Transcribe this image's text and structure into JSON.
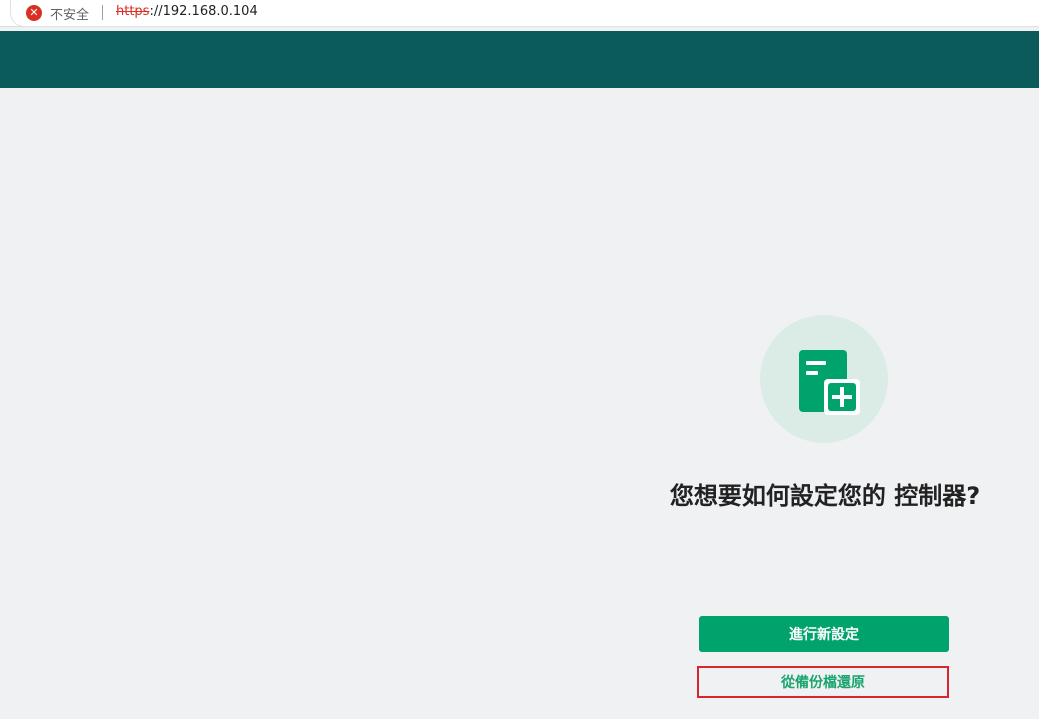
{
  "browser": {
    "security_label": "不安全",
    "url_scheme": "https",
    "url_rest": "://192.168.0.104"
  },
  "setup": {
    "icon": "document-add-icon",
    "question": "您想要如何設定您的 控制器?",
    "new_setup_label": "進行新設定",
    "restore_label": "從備份檔還原"
  },
  "colors": {
    "header": "#0b5b5b",
    "accent": "#00a36b",
    "icon_circle": "#dbece7",
    "highlight_border": "#d9252f"
  }
}
